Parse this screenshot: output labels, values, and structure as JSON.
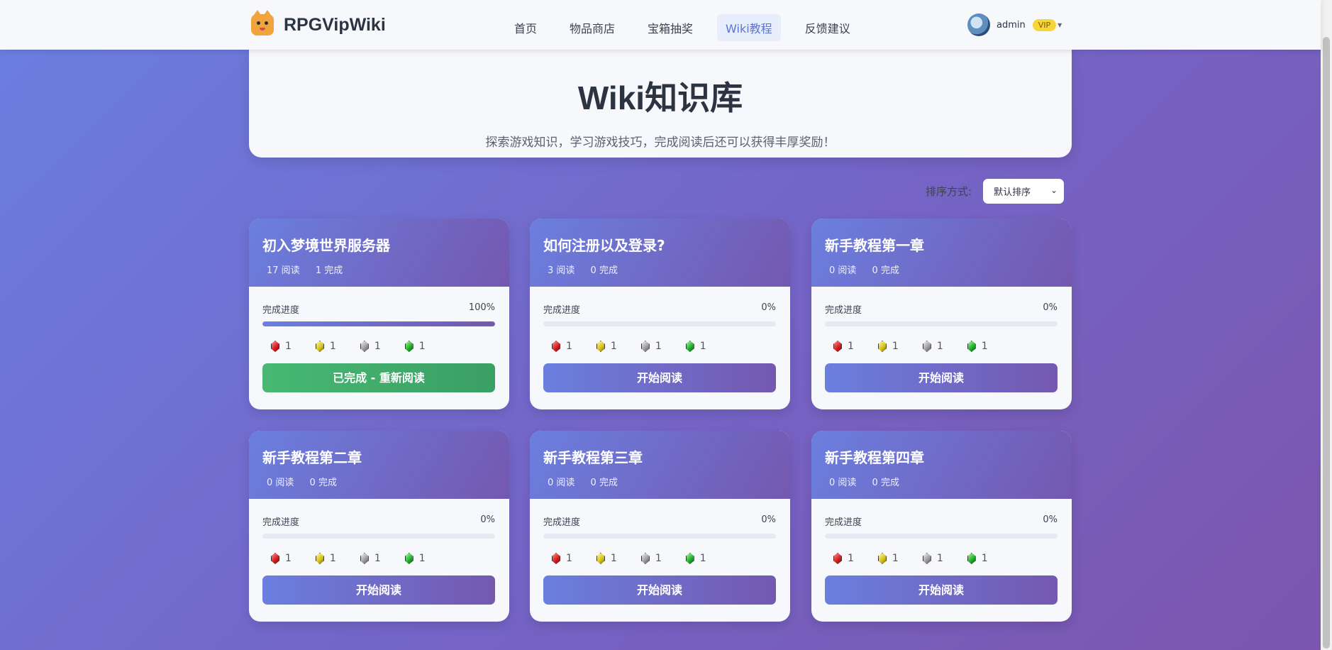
{
  "brand": {
    "name": "RPGVipWiki"
  },
  "nav": {
    "items": [
      {
        "label": "首页"
      },
      {
        "label": "物品商店"
      },
      {
        "label": "宝箱抽奖"
      },
      {
        "label": "Wiki教程",
        "active": true
      },
      {
        "label": "反馈建议"
      }
    ]
  },
  "user": {
    "name": "admin",
    "badge": "VIP",
    "caret": "▾"
  },
  "hero": {
    "title": "Wiki知识库",
    "subtitle": "探索游戏知识，学习游戏技巧，完成阅读后还可以获得丰厚奖励！"
  },
  "sort": {
    "label": "排序方式:",
    "selected": "默认排序"
  },
  "cards": [
    {
      "title": "初入梦境世界服务器",
      "reads": "17 阅读",
      "completes": "1 完成",
      "progress_label": "完成进度",
      "progress_text": "100%",
      "progress": 100,
      "rewards": [
        {
          "color": "red",
          "count": "1"
        },
        {
          "color": "yellow",
          "count": "1"
        },
        {
          "color": "gray",
          "count": "1"
        },
        {
          "color": "green",
          "count": "1"
        }
      ],
      "button": "已完成 - 重新阅读",
      "completed": true
    },
    {
      "title": "如何注册以及登录?",
      "reads": "3 阅读",
      "completes": "0 完成",
      "progress_label": "完成进度",
      "progress_text": "0%",
      "progress": 0,
      "rewards": [
        {
          "color": "red",
          "count": "1"
        },
        {
          "color": "yellow",
          "count": "1"
        },
        {
          "color": "gray",
          "count": "1"
        },
        {
          "color": "green",
          "count": "1"
        }
      ],
      "button": "开始阅读",
      "completed": false
    },
    {
      "title": "新手教程第一章",
      "reads": "0 阅读",
      "completes": "0 完成",
      "progress_label": "完成进度",
      "progress_text": "0%",
      "progress": 0,
      "rewards": [
        {
          "color": "red",
          "count": "1"
        },
        {
          "color": "yellow",
          "count": "1"
        },
        {
          "color": "gray",
          "count": "1"
        },
        {
          "color": "green",
          "count": "1"
        }
      ],
      "button": "开始阅读",
      "completed": false
    },
    {
      "title": "新手教程第二章",
      "reads": "0 阅读",
      "completes": "0 完成",
      "progress_label": "完成进度",
      "progress_text": "0%",
      "progress": 0,
      "rewards": [
        {
          "color": "red",
          "count": "1"
        },
        {
          "color": "yellow",
          "count": "1"
        },
        {
          "color": "gray",
          "count": "1"
        },
        {
          "color": "green",
          "count": "1"
        }
      ],
      "button": "开始阅读",
      "completed": false
    },
    {
      "title": "新手教程第三章",
      "reads": "0 阅读",
      "completes": "0 完成",
      "progress_label": "完成进度",
      "progress_text": "0%",
      "progress": 0,
      "rewards": [
        {
          "color": "red",
          "count": "1"
        },
        {
          "color": "yellow",
          "count": "1"
        },
        {
          "color": "gray",
          "count": "1"
        },
        {
          "color": "green",
          "count": "1"
        }
      ],
      "button": "开始阅读",
      "completed": false
    },
    {
      "title": "新手教程第四章",
      "reads": "0 阅读",
      "completes": "0 完成",
      "progress_label": "完成进度",
      "progress_text": "0%",
      "progress": 0,
      "rewards": [
        {
          "color": "red",
          "count": "1"
        },
        {
          "color": "yellow",
          "count": "1"
        },
        {
          "color": "gray",
          "count": "1"
        },
        {
          "color": "green",
          "count": "1"
        }
      ],
      "button": "开始阅读",
      "completed": false
    }
  ],
  "colors": {
    "accent": "#6b7fdf",
    "accent_end": "#7458b0",
    "done": "#48b874",
    "vip": "#f6d53a"
  }
}
